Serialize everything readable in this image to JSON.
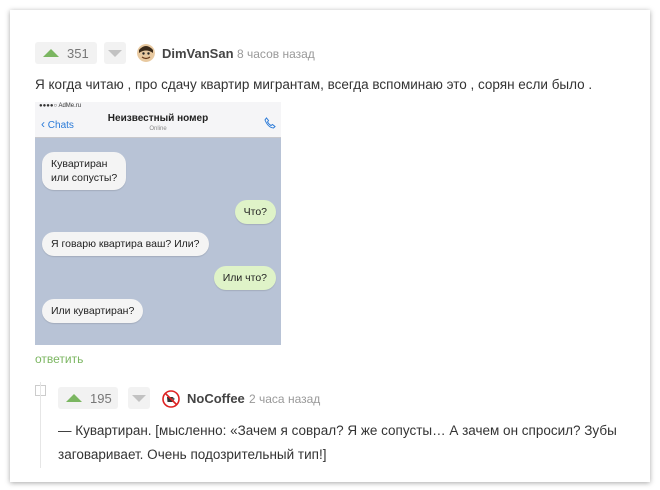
{
  "comment": {
    "rating": "351",
    "username": "DimVanSan",
    "time": "8 часов назад",
    "text": "Я когда читаю , про сдачу квартир мигрантам, всегда вспоминаю это , сорян если было .",
    "reply_label": "ответить"
  },
  "phone": {
    "status_text": "●●●●○ AdMe.ru",
    "back_label": "Chats",
    "contact_name": "Неизвестный номер",
    "contact_status": "Online",
    "messages": [
      {
        "dir": "in",
        "line1": "Кувартиран",
        "line2": "или сопусты?"
      },
      {
        "dir": "out",
        "line1": "Что?"
      },
      {
        "dir": "in",
        "line1": "Я говарю квартира ваш? Или?"
      },
      {
        "dir": "out",
        "line1": "Или что?"
      },
      {
        "dir": "in",
        "line1": "Или кувартиран?"
      }
    ]
  },
  "reply": {
    "rating": "195",
    "username": "NoCoffee",
    "time": "2 часа назад",
    "line1": "— Кувартиран. [мысленно: «Зачем я соврал? Я же сопусты… А зачем он спросил? Зубы",
    "line2": "заговаривает. Очень подозрительный тип!]"
  },
  "colors": {
    "upvote": "#7bb661",
    "reply_link": "#7bb661",
    "chat_background": "#b8c3d6",
    "outgoing_bubble": "#dff3c8",
    "incoming_bubble": "#f4f4f4"
  }
}
